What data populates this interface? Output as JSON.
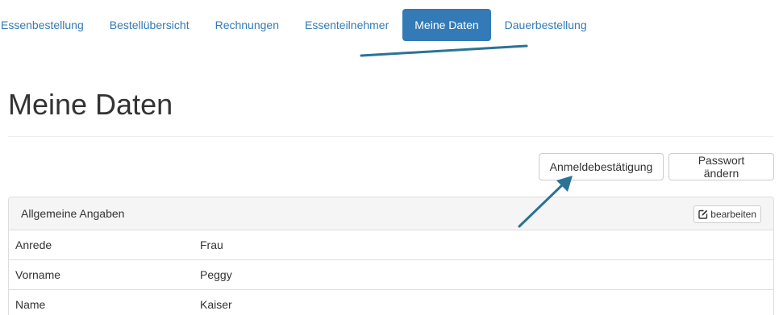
{
  "nav": {
    "items": [
      {
        "label": "Essenbestellung",
        "active": false
      },
      {
        "label": "Bestellübersicht",
        "active": false
      },
      {
        "label": "Rechnungen",
        "active": false
      },
      {
        "label": "Essenteilnehmer",
        "active": false
      },
      {
        "label": "Meine Daten",
        "active": true
      },
      {
        "label": "Dauerbestellung",
        "active": false
      }
    ]
  },
  "page": {
    "title": "Meine Daten"
  },
  "actions": {
    "confirm_label": "Anmeldebestätigung",
    "password_label": "Passwort ändern"
  },
  "panel": {
    "title": "Allgemeine Angaben",
    "edit_label": "bearbeiten",
    "rows": [
      {
        "label": "Anrede",
        "value": "Frau"
      },
      {
        "label": "Vorname",
        "value": "Peggy"
      },
      {
        "label": "Name",
        "value": "Kaiser"
      }
    ]
  },
  "colors": {
    "accent": "#337ab7",
    "annotation_arrow": "#2a7397"
  },
  "icons": {
    "edit": "edit-square-icon"
  }
}
